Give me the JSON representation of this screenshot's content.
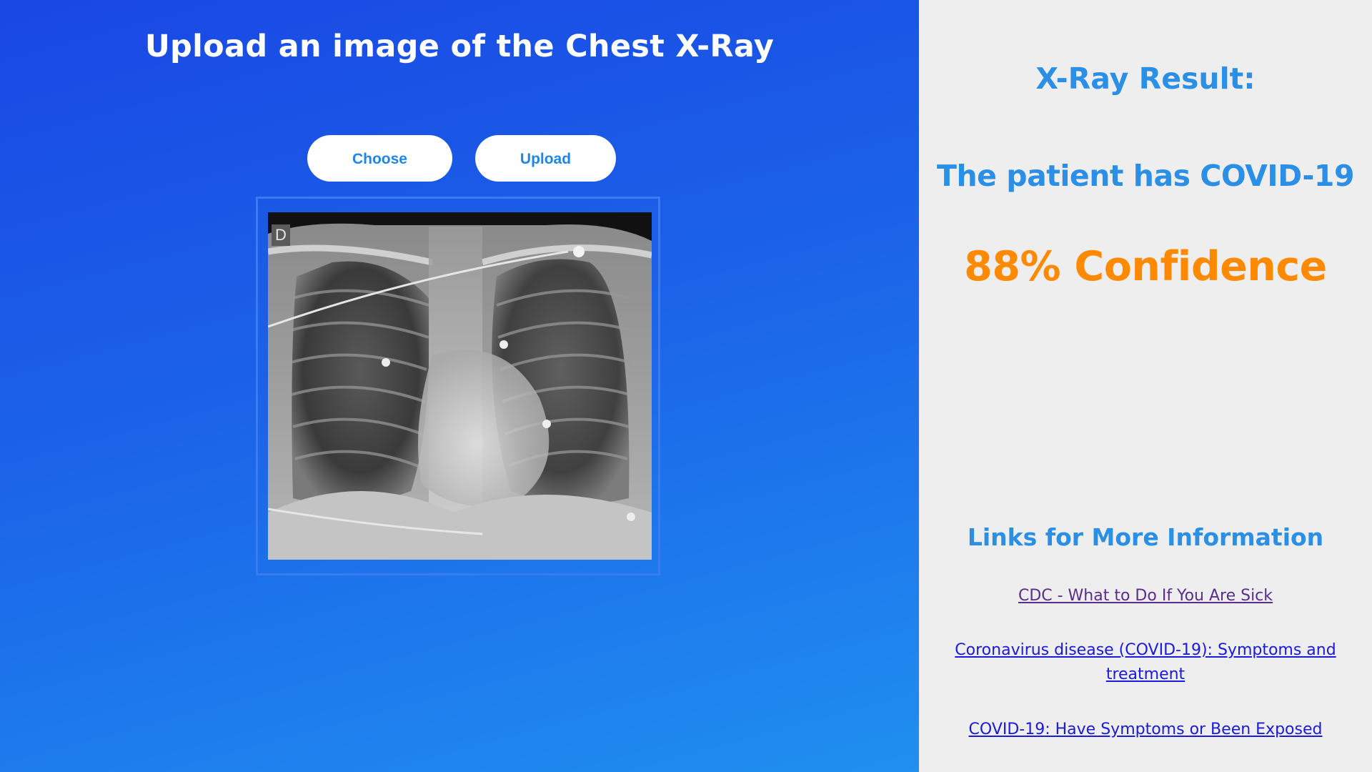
{
  "upload": {
    "title": "Upload an image of the Chest X-Ray",
    "choose_label": "Choose",
    "upload_label": "Upload",
    "image_marker": "D"
  },
  "result": {
    "heading": "X-Ray Result:",
    "diagnosis": "The patient has COVID-19",
    "confidence": "88% Confidence"
  },
  "links": {
    "heading": "Links for More Information",
    "items": [
      {
        "label": "CDC - What to Do If You Are Sick"
      },
      {
        "label": "Coronavirus disease (COVID-19): Symptoms and treatment"
      },
      {
        "label": "COVID-19: Have Symptoms or Been Exposed"
      }
    ]
  },
  "colors": {
    "left_gradient_start": "#1a47e4",
    "left_gradient_end": "#1f8ff0",
    "right_background": "#eeeeee",
    "result_blue": "#2b8fe6",
    "confidence_orange": "#ff8a00",
    "visited_link": "#5a2d8c",
    "link": "#1a1adb"
  }
}
